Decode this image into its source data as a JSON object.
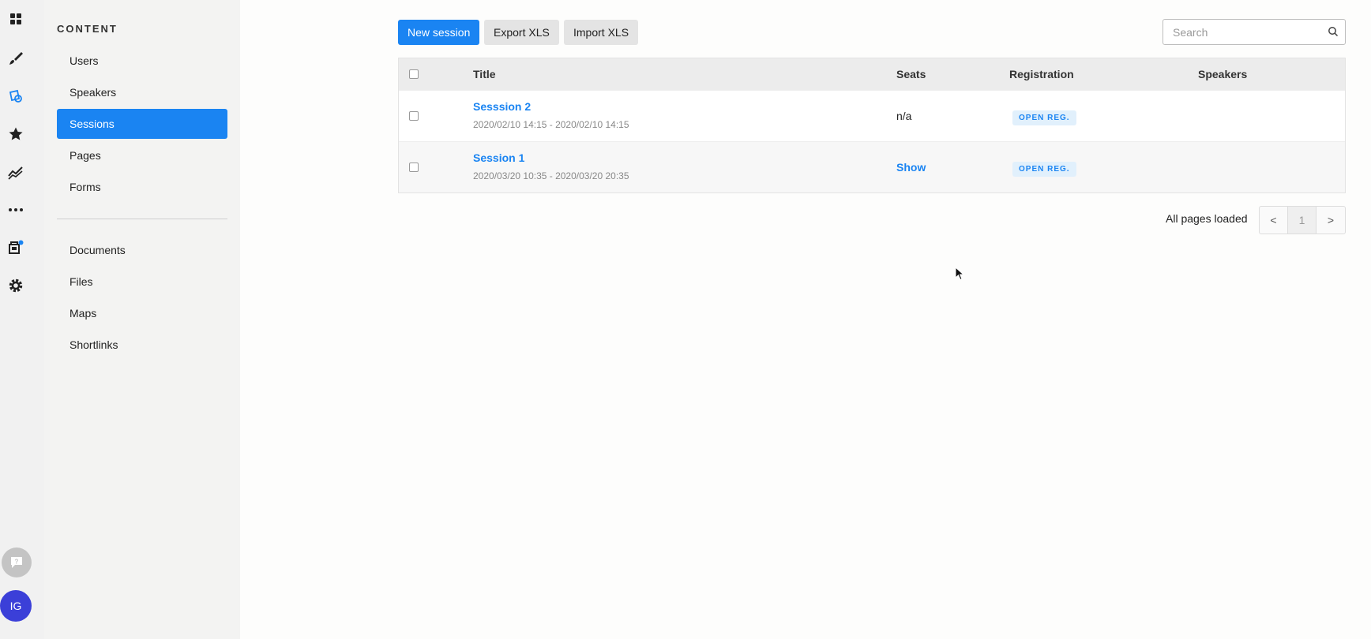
{
  "rail": {
    "icons": [
      "dashboard-icon",
      "brush-icon",
      "content-icon",
      "star-icon",
      "analytics-icon",
      "more-icon",
      "store-icon",
      "settings-icon"
    ],
    "avatar_initials": "IG",
    "accent": "#1a84f2"
  },
  "sidebar": {
    "section_title": "CONTENT",
    "items": [
      {
        "label": "Users"
      },
      {
        "label": "Speakers"
      },
      {
        "label": "Sessions",
        "active": true
      },
      {
        "label": "Pages"
      },
      {
        "label": "Forms"
      }
    ],
    "items2": [
      {
        "label": "Documents"
      },
      {
        "label": "Files"
      },
      {
        "label": "Maps"
      },
      {
        "label": "Shortlinks"
      }
    ]
  },
  "toolbar": {
    "new_label": "New session",
    "export_label": "Export XLS",
    "import_label": "Import XLS",
    "search_placeholder": "Search"
  },
  "table": {
    "headers": {
      "title": "Title",
      "seats": "Seats",
      "registration": "Registration",
      "speakers": "Speakers"
    },
    "rows": [
      {
        "title": "Sesssion 2",
        "dates": "2020/02/10 14:15 - 2020/02/10 14:15",
        "seats": "n/a",
        "registration": "OPEN REG."
      },
      {
        "title": "Session 1",
        "dates": "2020/03/20 10:35 - 2020/03/20 20:35",
        "seats": "Show",
        "registration": "OPEN REG."
      }
    ]
  },
  "pagination": {
    "status": "All pages loaded",
    "prev": "<",
    "current": "1",
    "next": ">"
  }
}
